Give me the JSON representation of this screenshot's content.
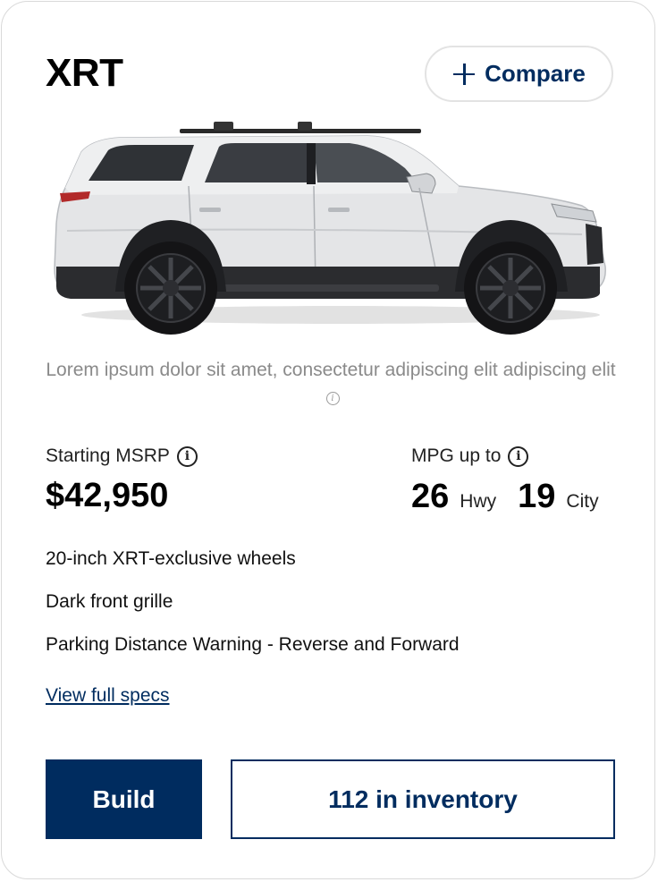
{
  "card": {
    "trim_name": "XRT",
    "compare_label": "Compare",
    "disclaimer": "Lorem ipsum dolor sit amet, consectetur adipiscing elit adipiscing elit",
    "msrp_label": "Starting MSRP",
    "price": "$42,950",
    "mpg_label": "MPG up to",
    "mpg_hwy": "26",
    "mpg_hwy_unit": "Hwy",
    "mpg_city": "19",
    "mpg_city_unit": "City",
    "features": [
      "20-inch XRT-exclusive wheels",
      "Dark front grille",
      "Parking Distance Warning - Reverse and Forward"
    ],
    "specs_link": "View full specs",
    "build_label": "Build",
    "inventory_label": "112 in inventory"
  },
  "icons": {
    "compare": "plus-icon",
    "info": "info-icon",
    "vehicle": "suv-image"
  },
  "colors": {
    "brand_navy": "#002c5f",
    "muted_text": "#8a8a8a",
    "border": "#d9d9d9"
  }
}
